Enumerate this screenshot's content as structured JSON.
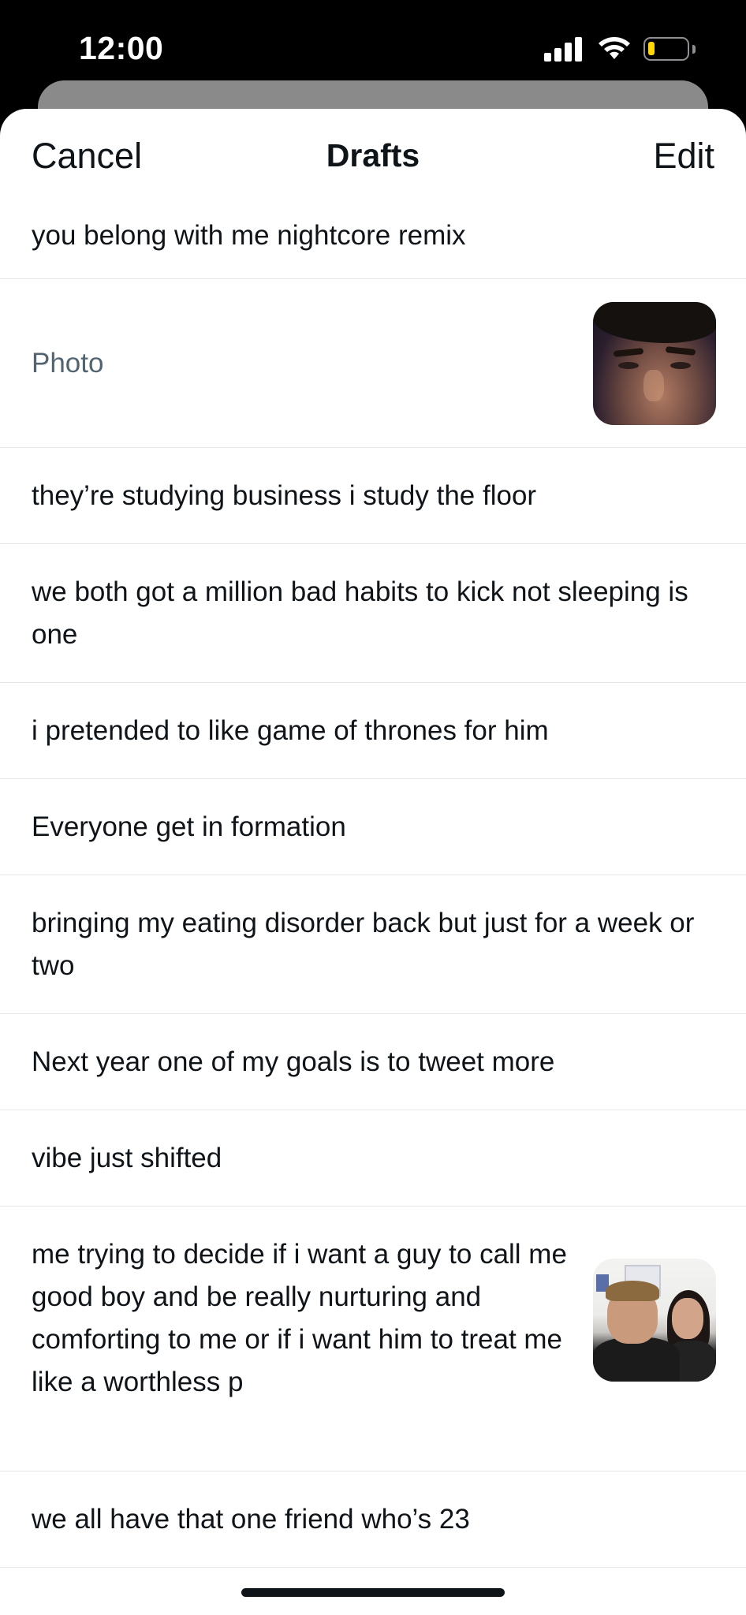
{
  "status_bar": {
    "time": "12:00",
    "icons": [
      "cellular-signal-icon",
      "wifi-icon",
      "battery-icon"
    ],
    "battery_color": "#ffd60a"
  },
  "header": {
    "cancel_label": "Cancel",
    "title": "Drafts",
    "edit_label": "Edit"
  },
  "drafts": [
    {
      "text": "you belong with me nightcore remix"
    },
    {
      "text": "Photo",
      "has_image": true,
      "image": "selfie-photo-thumbnail"
    },
    {
      "text": "they’re studying business i study the floor"
    },
    {
      "text": "we both got a million bad habits to kick not sleeping is one"
    },
    {
      "text": "i pretended to like game of thrones for him"
    },
    {
      "text": "Everyone get in formation"
    },
    {
      "text": "bringing my eating disorder back but just for a week or two"
    },
    {
      "text": "Next year one of my goals is to tweet more"
    },
    {
      "text": "vibe just shifted"
    },
    {
      "text": "me trying to decide if i want a guy to call me good boy and be really nurturing and comforting to me or if i want him to treat me like a worthless p",
      "has_image": true,
      "image": "classroom-meme-thumbnail"
    },
    {
      "text": "we all have that one friend who’s 23"
    }
  ],
  "colors": {
    "text_primary": "#0f1419",
    "text_muted": "#536471",
    "divider": "#e6e9ec"
  }
}
